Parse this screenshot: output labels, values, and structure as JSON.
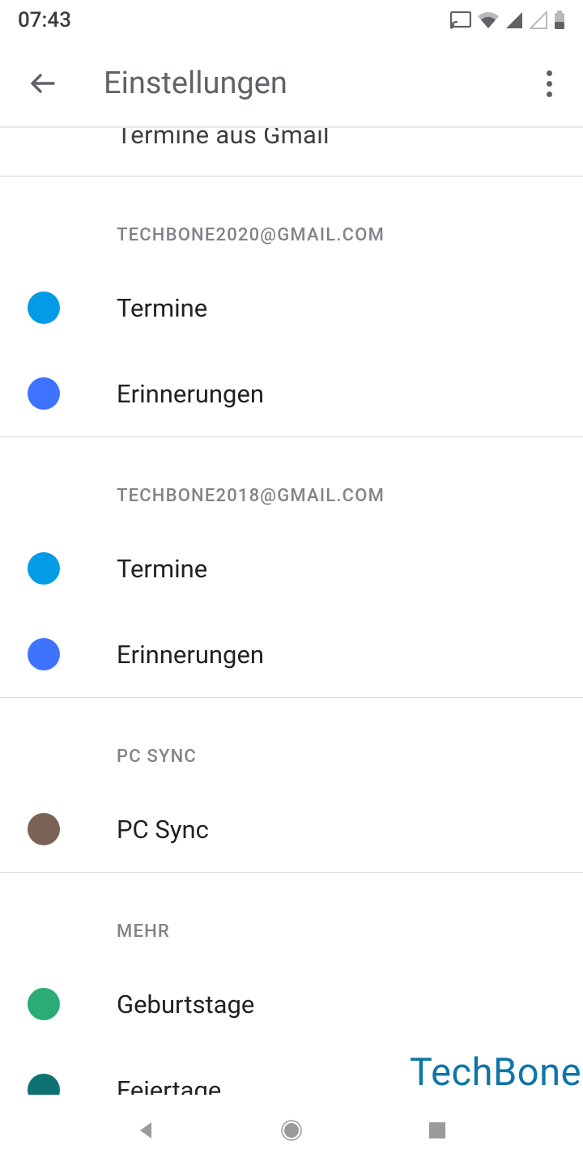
{
  "status_bar": {
    "time": "07:43"
  },
  "app_bar": {
    "title": "Einstellungen"
  },
  "partial_row": {
    "label": "Termine aus Gmail"
  },
  "sections": [
    {
      "header": "TECHBONE2020@GMAIL.COM",
      "items": [
        {
          "label": "Termine",
          "color": "#039be5"
        },
        {
          "label": "Erinnerungen",
          "color": "#3d73ff"
        }
      ]
    },
    {
      "header": "TECHBONE2018@GMAIL.COM",
      "items": [
        {
          "label": "Termine",
          "color": "#039be5"
        },
        {
          "label": "Erinnerungen",
          "color": "#3d73ff"
        }
      ]
    },
    {
      "header": "PC SYNC",
      "items": [
        {
          "label": "PC Sync",
          "color": "#7a6257"
        }
      ]
    },
    {
      "header": "MEHR",
      "items": [
        {
          "label": "Geburtstage",
          "color": "#2bab76"
        },
        {
          "label": "Feiertage",
          "color": "#0e7272"
        }
      ]
    }
  ],
  "watermark": "TechBone"
}
